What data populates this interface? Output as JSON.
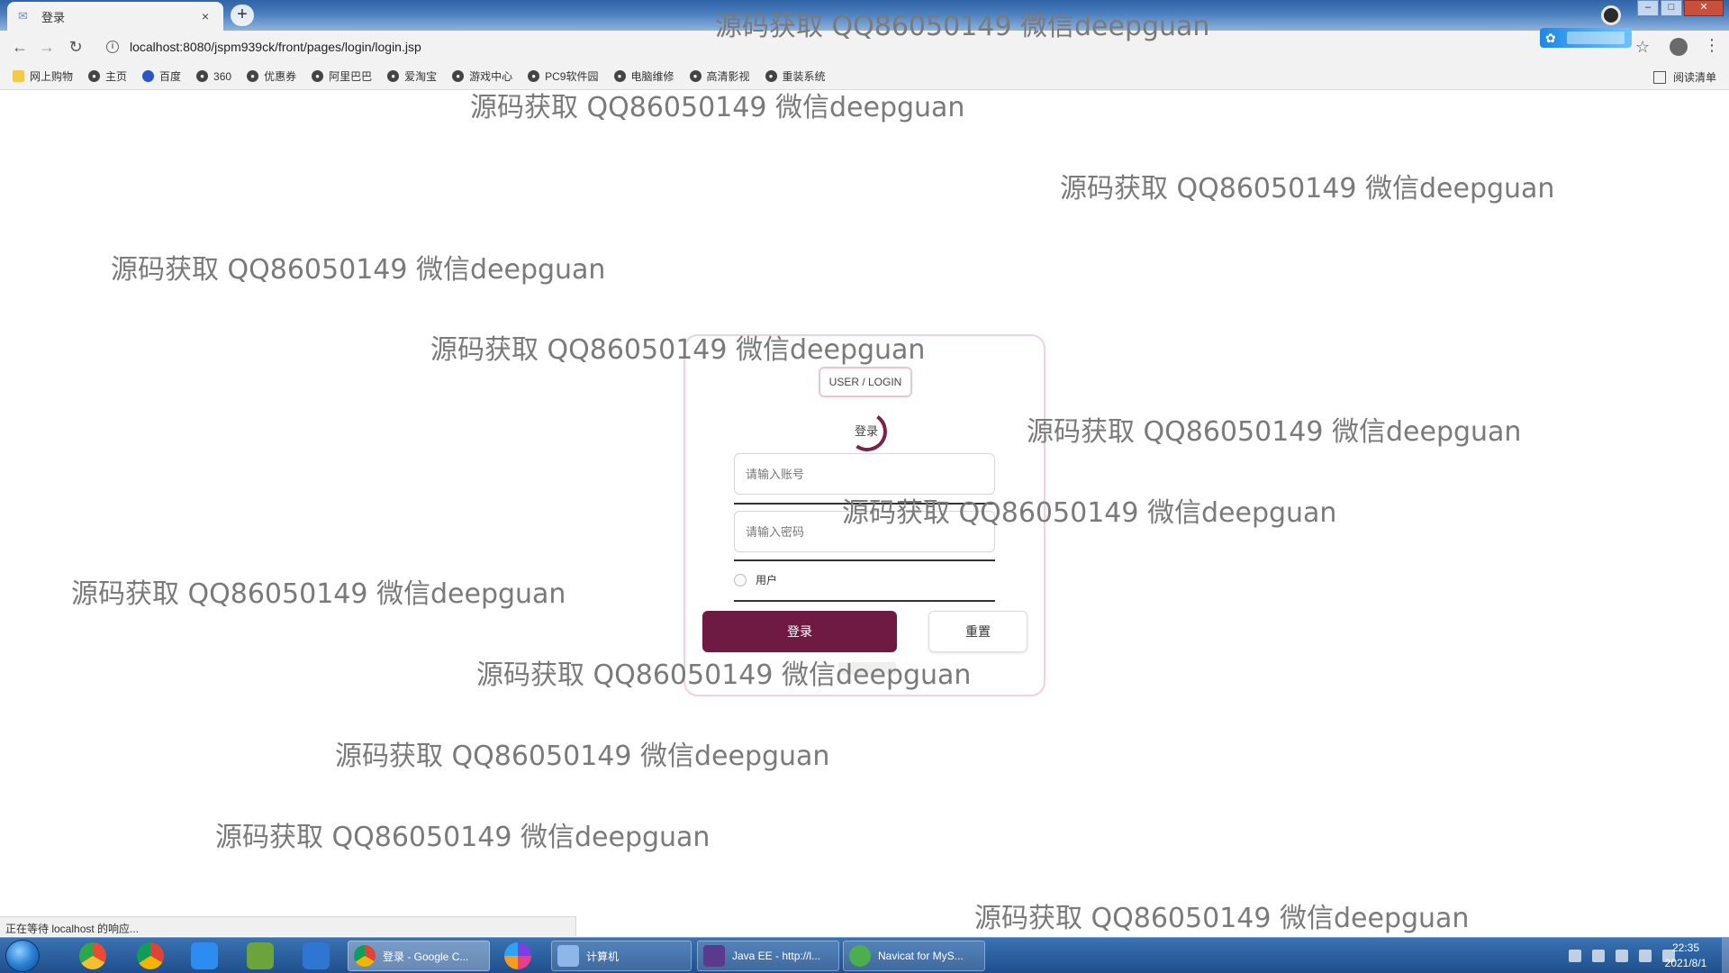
{
  "browser": {
    "tab_title": "登录",
    "tab_close": "×",
    "new_tab": "+",
    "url": "localhost:8080/jspm939ck/front/pages/login/login.jsp",
    "bookmarks": [
      {
        "label": "网上购物",
        "icon": "folder-icon"
      },
      {
        "label": "主页",
        "icon": "globe-icon"
      },
      {
        "label": "百度",
        "icon": "baidu-paw-icon"
      },
      {
        "label": "360",
        "icon": "globe-icon"
      },
      {
        "label": "优惠券",
        "icon": "globe-icon"
      },
      {
        "label": "阿里巴巴",
        "icon": "globe-icon"
      },
      {
        "label": "爱淘宝",
        "icon": "globe-icon"
      },
      {
        "label": "游戏中心",
        "icon": "globe-icon"
      },
      {
        "label": "PC9软件园",
        "icon": "globe-icon"
      },
      {
        "label": "电脑维修",
        "icon": "globe-icon"
      },
      {
        "label": "高清影视",
        "icon": "globe-icon"
      },
      {
        "label": "重装系统",
        "icon": "globe-icon"
      }
    ],
    "reading_list": "阅读清单",
    "status": "正在等待 localhost 的响应..."
  },
  "login": {
    "badge": "USER / LOGIN",
    "title": "登录",
    "username_placeholder": "请输入账号",
    "password_placeholder": "请输入密码",
    "role_label": "用户",
    "login_button": "登录",
    "reset_button": "重置"
  },
  "watermark": "源码获取 QQ86050149 微信deepguan",
  "taskbar": {
    "tasks": [
      {
        "label": "登录 - Google C...",
        "icon": "chrome-icon",
        "active": true
      },
      {
        "label": "计算机",
        "icon": "computer-icon"
      },
      {
        "label": "Java EE - http://l...",
        "icon": "eclipse-icon"
      },
      {
        "label": "Navicat for MyS...",
        "icon": "navicat-icon"
      }
    ],
    "clock_time": "22:35",
    "clock_date": "2021/8/1"
  },
  "colors": {
    "accent": "#6e1a43",
    "card_border": "#f2d2d9",
    "taskbar": "#1f4f8c"
  }
}
